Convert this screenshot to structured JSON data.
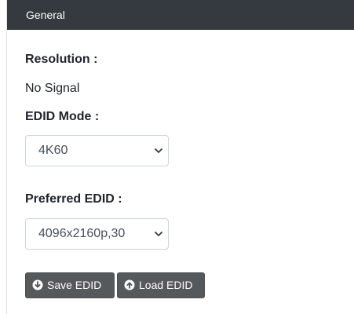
{
  "panel": {
    "title": "General"
  },
  "resolution": {
    "label": "Resolution :",
    "value": "No Signal"
  },
  "edid_mode": {
    "label": "EDID Mode :",
    "selected": "4K60"
  },
  "preferred_edid": {
    "label": "Preferred EDID :",
    "selected": "4096x2160p,30"
  },
  "actions": {
    "save_label": "Save EDID",
    "load_label": "Load EDID"
  },
  "icons": {
    "save": "circle-arrow-down-icon",
    "load": "circle-arrow-up-icon",
    "dropdown": "chevron-down-icon"
  },
  "colors": {
    "header_bg": "#343a40",
    "button_bg": "#55595c"
  }
}
